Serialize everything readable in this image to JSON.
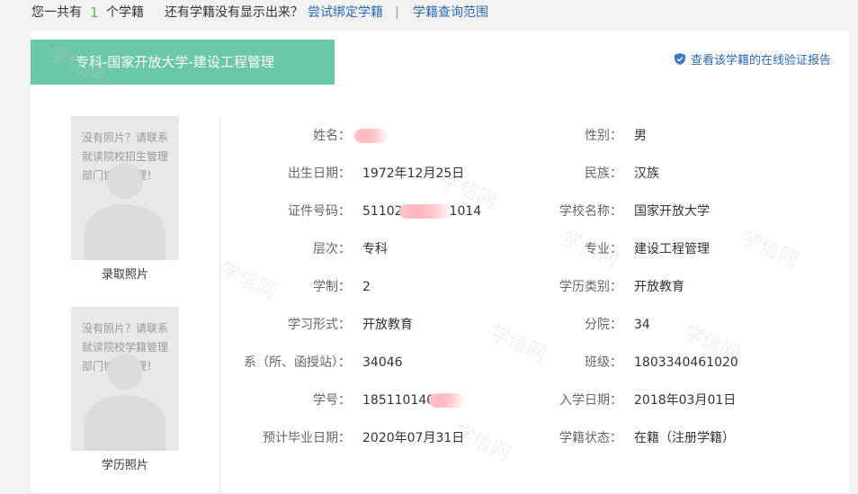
{
  "topbar": {
    "prefix": "您一共有",
    "count": "1",
    "suffix": "个学籍",
    "question": "还有学籍没有显示出来？",
    "bind_link": "尝试绑定学籍",
    "separator": "|",
    "scope_link": "学籍查询范围"
  },
  "card": {
    "title": "专科-国家开放大学-建设工程管理",
    "verify_link": "查看该学籍的在线验证报告",
    "watermark": "学信网"
  },
  "photos": {
    "admission": {
      "message": "没有照片？请联系就读院校招生管理部门协助处理！",
      "caption": "录取照片"
    },
    "education": {
      "message": "没有照片？请联系就读院校学籍管理部门协助处理！",
      "caption": "学历照片"
    }
  },
  "fields": {
    "name": {
      "label": "姓名：",
      "value": ""
    },
    "gender": {
      "label": "性别：",
      "value": "男"
    },
    "birth": {
      "label": "出生日期：",
      "value": "1972年12月25日"
    },
    "ethnicity": {
      "label": "民族：",
      "value": "汉族"
    },
    "id_number": {
      "label": "证件号码：",
      "value_prefix": "51102",
      "value_suffix": "1014"
    },
    "school": {
      "label": "学校名称：",
      "value": "国家开放大学"
    },
    "level": {
      "label": "层次：",
      "value": "专科"
    },
    "major": {
      "label": "专业：",
      "value": "建设工程管理"
    },
    "duration": {
      "label": "学制：",
      "value": "2"
    },
    "edu_type": {
      "label": "学历类别：",
      "value": "开放教育"
    },
    "study_form": {
      "label": "学习形式：",
      "value": "开放教育"
    },
    "branch": {
      "label": "分院：",
      "value": "34"
    },
    "department": {
      "label": "系（所、函授站）：",
      "value": "34046"
    },
    "class": {
      "label": "班级：",
      "value": "1803340461020"
    },
    "student_id": {
      "label": "学号：",
      "value": "185110140"
    },
    "enroll_date": {
      "label": "入学日期：",
      "value": "2018年03月01日"
    },
    "grad_date": {
      "label": "预计毕业日期：",
      "value": "2020年07月31日"
    },
    "status": {
      "label": "学籍状态：",
      "value": "在籍（注册学籍）"
    }
  },
  "colors": {
    "accent": "#6bc8a6",
    "link": "#2a6ab8",
    "count": "#5cb85c"
  }
}
